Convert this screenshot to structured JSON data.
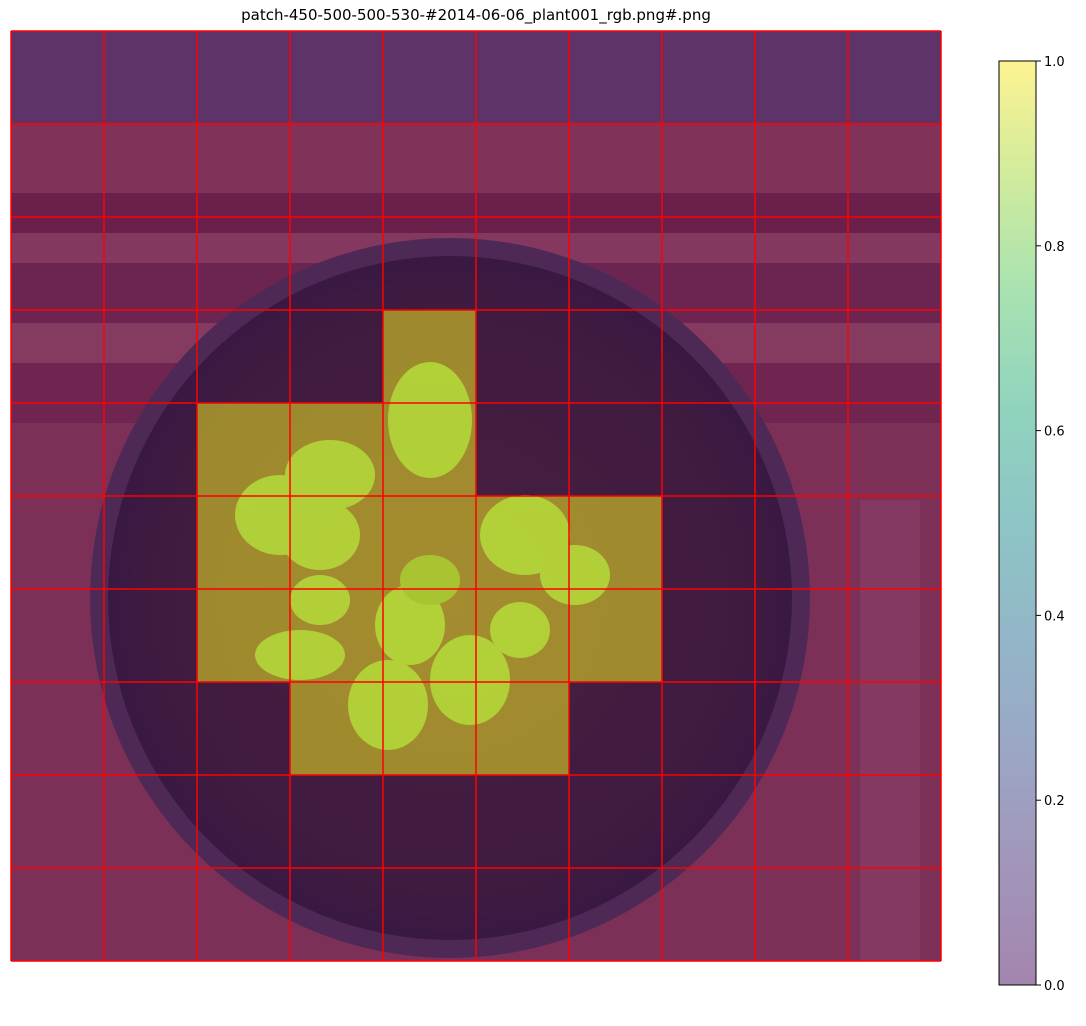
{
  "title": "patch-450-500-500-530-#2014-06-06_plant001_rgb.png#.png",
  "chart_data": {
    "type": "heatmap",
    "title": "patch-450-500-500-530-#2014-06-06_plant001_rgb.png#.png",
    "description_of_background": "top-down photo of a potted plant overlaid with a patch mask",
    "grid": true,
    "grid_color": "#ff0000",
    "rows": 10,
    "cols": 10,
    "mask": [
      [
        0,
        0,
        0,
        0,
        0,
        0,
        0,
        0,
        0,
        0
      ],
      [
        0,
        0,
        0,
        0,
        0,
        0,
        0,
        0,
        0,
        0
      ],
      [
        0,
        0,
        0,
        0,
        0,
        0,
        0,
        0,
        0,
        0
      ],
      [
        0,
        0,
        0,
        0,
        1,
        0,
        0,
        0,
        0,
        0
      ],
      [
        0,
        0,
        1,
        1,
        1,
        0,
        0,
        0,
        0,
        0
      ],
      [
        0,
        0,
        1,
        1,
        1,
        1,
        1,
        0,
        0,
        0
      ],
      [
        0,
        0,
        1,
        1,
        1,
        1,
        1,
        0,
        0,
        0
      ],
      [
        0,
        0,
        0,
        1,
        1,
        1,
        0,
        0,
        0,
        0
      ],
      [
        0,
        0,
        0,
        0,
        0,
        0,
        0,
        0,
        0,
        0
      ],
      [
        0,
        0,
        0,
        0,
        0,
        0,
        0,
        0,
        0,
        0
      ]
    ],
    "colorbar": {
      "min": 0.0,
      "max": 1.0,
      "ticks": [
        "0.0",
        "0.2",
        "0.4",
        "0.6",
        "0.8",
        "1.0"
      ],
      "tick_values": [
        0.0,
        0.2,
        0.4,
        0.6,
        0.8,
        1.0
      ],
      "colormap": "viridis",
      "alpha": 0.5
    },
    "legend": "none"
  },
  "colors": {
    "grid": "#ff0000",
    "mask_on": "#fde725",
    "mask_off": "#440154",
    "wall": "#8a3d4e",
    "soil": "#3a2a35"
  }
}
